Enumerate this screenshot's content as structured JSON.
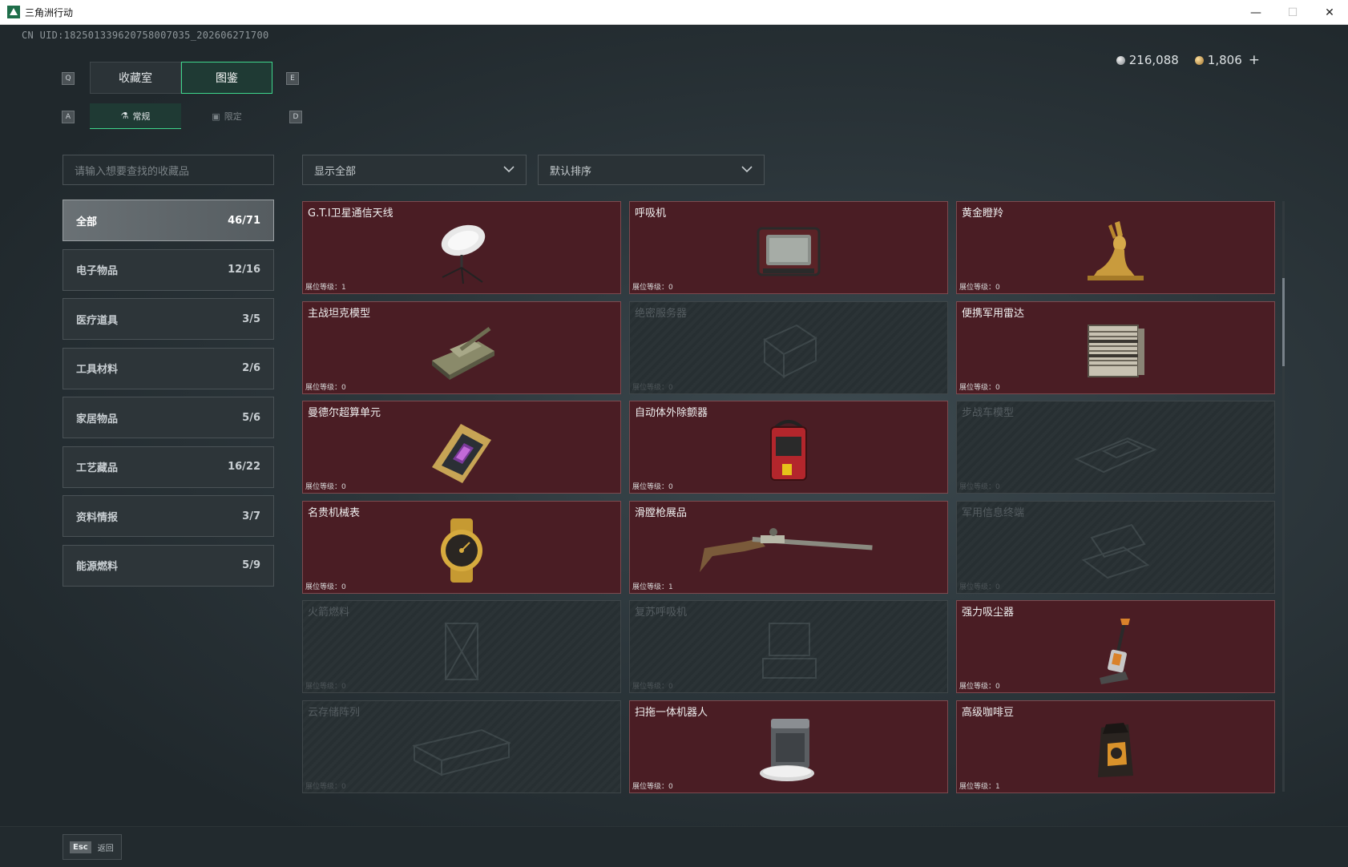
{
  "window": {
    "title": "三角洲行动",
    "minimize": "—",
    "maximize": "☐",
    "close": "✕"
  },
  "uid": "CN UID:182501339620758007035_202606271700",
  "keys": {
    "prev_tab": "Q",
    "next_tab": "E",
    "prev_sub": "A",
    "next_sub": "D"
  },
  "tabs": [
    {
      "label": "收藏室",
      "active": false
    },
    {
      "label": "图鉴",
      "active": true
    }
  ],
  "subtabs": [
    {
      "label": "常规",
      "icon": "flask-icon",
      "active": true
    },
    {
      "label": "限定",
      "icon": "frame-icon",
      "active": false
    }
  ],
  "currency": {
    "silver": "216,088",
    "gold": "1,806",
    "add": "+"
  },
  "search": {
    "placeholder": "请输入想要查找的收藏品"
  },
  "filters": {
    "show": "显示全部",
    "sort": "默认排序"
  },
  "categories": [
    {
      "label": "全部",
      "count": "46/71",
      "active": true
    },
    {
      "label": "电子物品",
      "count": "12/16"
    },
    {
      "label": "医疗道具",
      "count": "3/5"
    },
    {
      "label": "工具材料",
      "count": "2/6"
    },
    {
      "label": "家居物品",
      "count": "5/6"
    },
    {
      "label": "工艺藏品",
      "count": "16/22"
    },
    {
      "label": "资料情报",
      "count": "3/7"
    },
    {
      "label": "能源燃料",
      "count": "5/9"
    }
  ],
  "items": [
    {
      "name": "G.T.I卫星通信天线",
      "level": "展位等级：1",
      "unlocked": true,
      "icon": "satellite-dish-icon"
    },
    {
      "name": "呼吸机",
      "level": "展位等级：0",
      "unlocked": true,
      "icon": "ventilator-icon"
    },
    {
      "name": "黄金瞪羚",
      "level": "展位等级：0",
      "unlocked": true,
      "icon": "gold-gazelle-icon"
    },
    {
      "name": "主战坦克模型",
      "level": "展位等级：0",
      "unlocked": true,
      "icon": "tank-model-icon"
    },
    {
      "name": "绝密服务器",
      "level": "展位等级：0",
      "unlocked": false,
      "icon": "server-icon"
    },
    {
      "name": "便携军用雷达",
      "level": "展位等级：0",
      "unlocked": true,
      "icon": "radar-icon"
    },
    {
      "name": "曼德尔超算单元",
      "level": "展位等级：0",
      "unlocked": true,
      "icon": "computing-unit-icon"
    },
    {
      "name": "自动体外除颤器",
      "level": "展位等级：0",
      "unlocked": true,
      "icon": "defibrillator-icon"
    },
    {
      "name": "步战车模型",
      "level": "展位等级：0",
      "unlocked": false,
      "icon": "ifv-model-icon"
    },
    {
      "name": "名贵机械表",
      "level": "展位等级：0",
      "unlocked": true,
      "icon": "watch-icon"
    },
    {
      "name": "滑膛枪展品",
      "level": "展位等级：1",
      "unlocked": true,
      "icon": "musket-icon"
    },
    {
      "name": "军用信息终端",
      "level": "展位等级：0",
      "unlocked": false,
      "icon": "terminal-icon"
    },
    {
      "name": "火箭燃料",
      "level": "展位等级：0",
      "unlocked": false,
      "icon": "rocket-fuel-icon"
    },
    {
      "name": "复苏呼吸机",
      "level": "展位等级：0",
      "unlocked": false,
      "icon": "resuscitator-icon"
    },
    {
      "name": "强力吸尘器",
      "level": "展位等级：0",
      "unlocked": true,
      "icon": "vacuum-icon"
    },
    {
      "name": "云存储阵列",
      "level": "展位等级：0",
      "unlocked": false,
      "icon": "storage-array-icon"
    },
    {
      "name": "扫拖一体机器人",
      "level": "展位等级：0",
      "unlocked": true,
      "icon": "robot-mop-icon"
    },
    {
      "name": "高级咖啡豆",
      "level": "展位等级：1",
      "unlocked": true,
      "icon": "coffee-beans-icon"
    }
  ],
  "footer": {
    "esc_key": "Esc",
    "back": "返回"
  }
}
